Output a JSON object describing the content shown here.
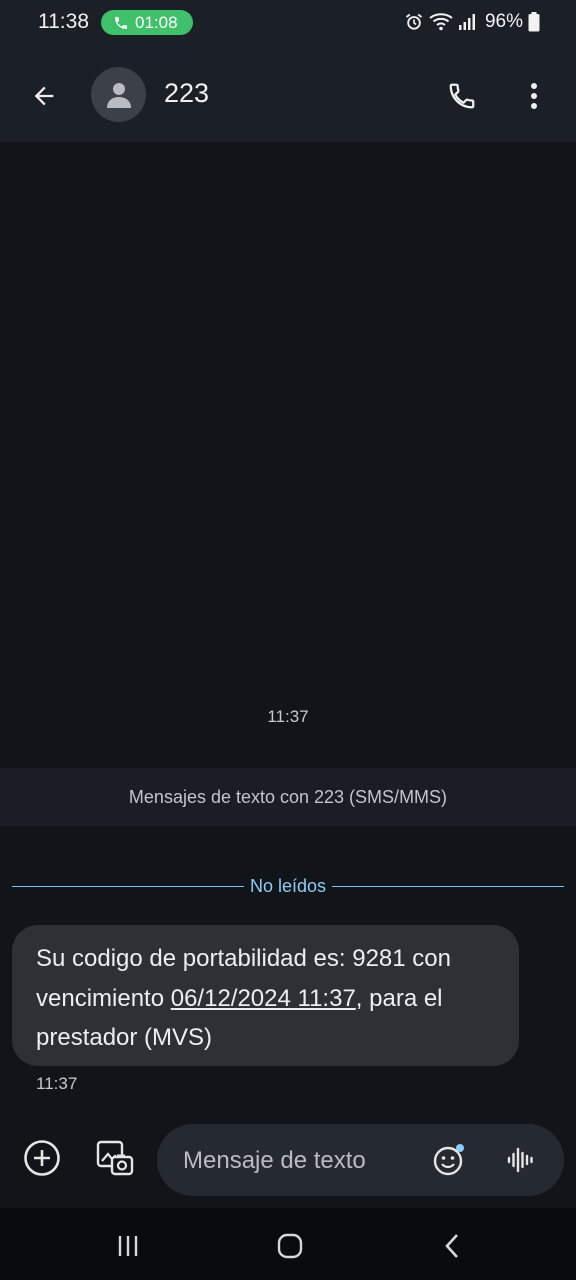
{
  "status_bar": {
    "time": "11:38",
    "call_timer": "01:08",
    "battery": "96%",
    "icons": [
      "alarm-icon",
      "wifi-icon",
      "signal-icon",
      "battery-icon"
    ],
    "call_color": "#3ec16a"
  },
  "app_bar": {
    "contact_name": "223",
    "icons": [
      "back-arrow-icon",
      "person-icon",
      "phone-icon",
      "more-vert-icon"
    ]
  },
  "conversation": {
    "top_timestamp": "11:37",
    "info_text": "Mensajes de texto con 223 (SMS/MMS)",
    "unread_label": "No leídos",
    "accent": "#8ccdf5",
    "message": {
      "text_part1": "Su codigo de portabilidad es: 9281 con vencimiento ",
      "date_link": "06/12/2024 11:37",
      "text_part2": ", para el prestador (MVS)",
      "time": "11:37"
    }
  },
  "composer": {
    "placeholder": "Mensaje de texto",
    "icons": [
      "add-circle-icon",
      "gallery-icon",
      "emoji-icon",
      "voice-icon"
    ]
  },
  "nav_bar": {
    "icons": [
      "recents-icon",
      "home-icon",
      "back-icon"
    ]
  }
}
